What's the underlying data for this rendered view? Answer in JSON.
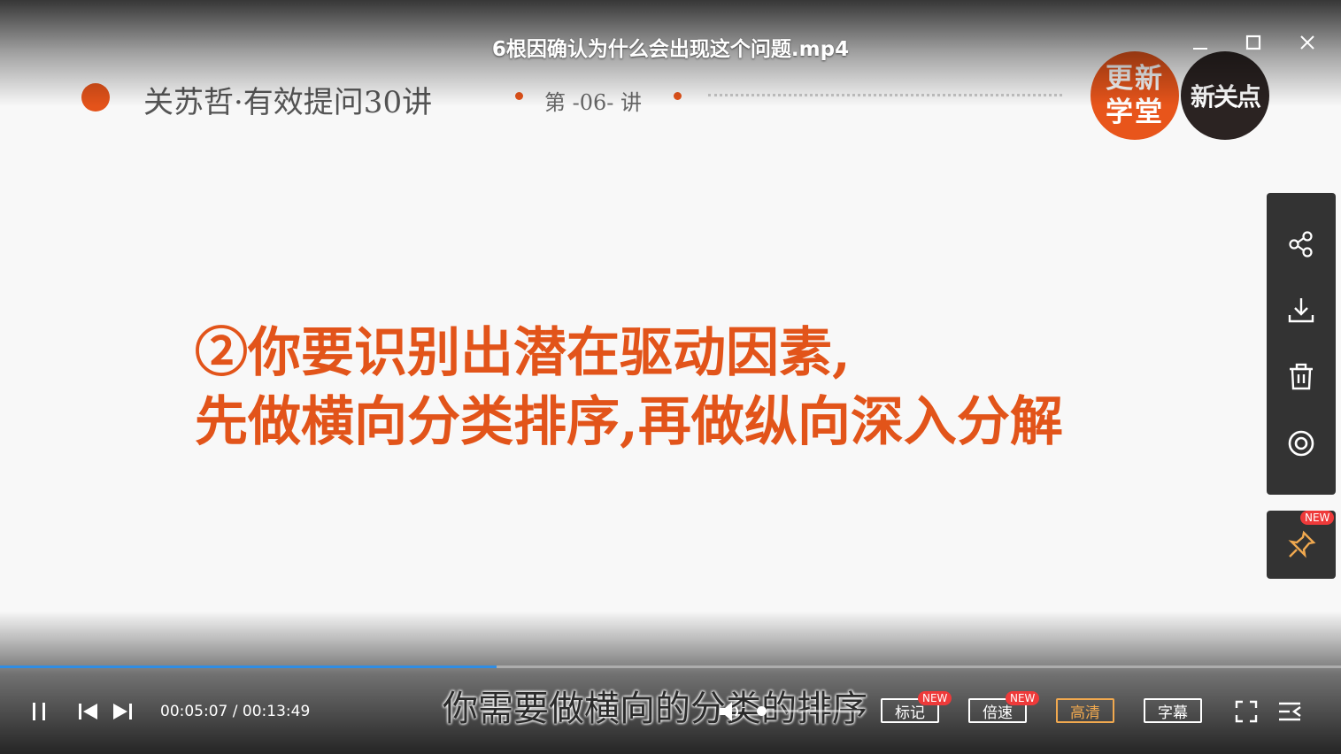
{
  "window": {
    "title": "6根因确认为什么会出现这个问题.mp4"
  },
  "slide": {
    "course_title": "关苏哲·有效提问30讲",
    "lecture": "第 -06- 讲",
    "logo_left_line1": "更新",
    "logo_left_line2": "学堂",
    "logo_right": "新关点",
    "line1": "②你要识别出潜在驱动因素,",
    "line2": "先做横向分类排序,再做纵向深入分解",
    "accent_color": "#e2541a"
  },
  "side_panel": {
    "items": [
      "share-icon",
      "download-icon",
      "trash-icon",
      "target-icon"
    ],
    "pin_badge": "NEW"
  },
  "player": {
    "current_time": "00:05:07",
    "separator": " / ",
    "duration": "00:13:49",
    "progress_fraction": 0.37,
    "volume_fraction": 0.0,
    "subtitle": "你需要做横向的分类的排序",
    "buttons": {
      "mark": "标记",
      "mark_badge": "NEW",
      "speed": "倍速",
      "speed_badge": "NEW",
      "quality": "高清",
      "caption": "字幕"
    },
    "progress_color": "#2f8de4"
  }
}
